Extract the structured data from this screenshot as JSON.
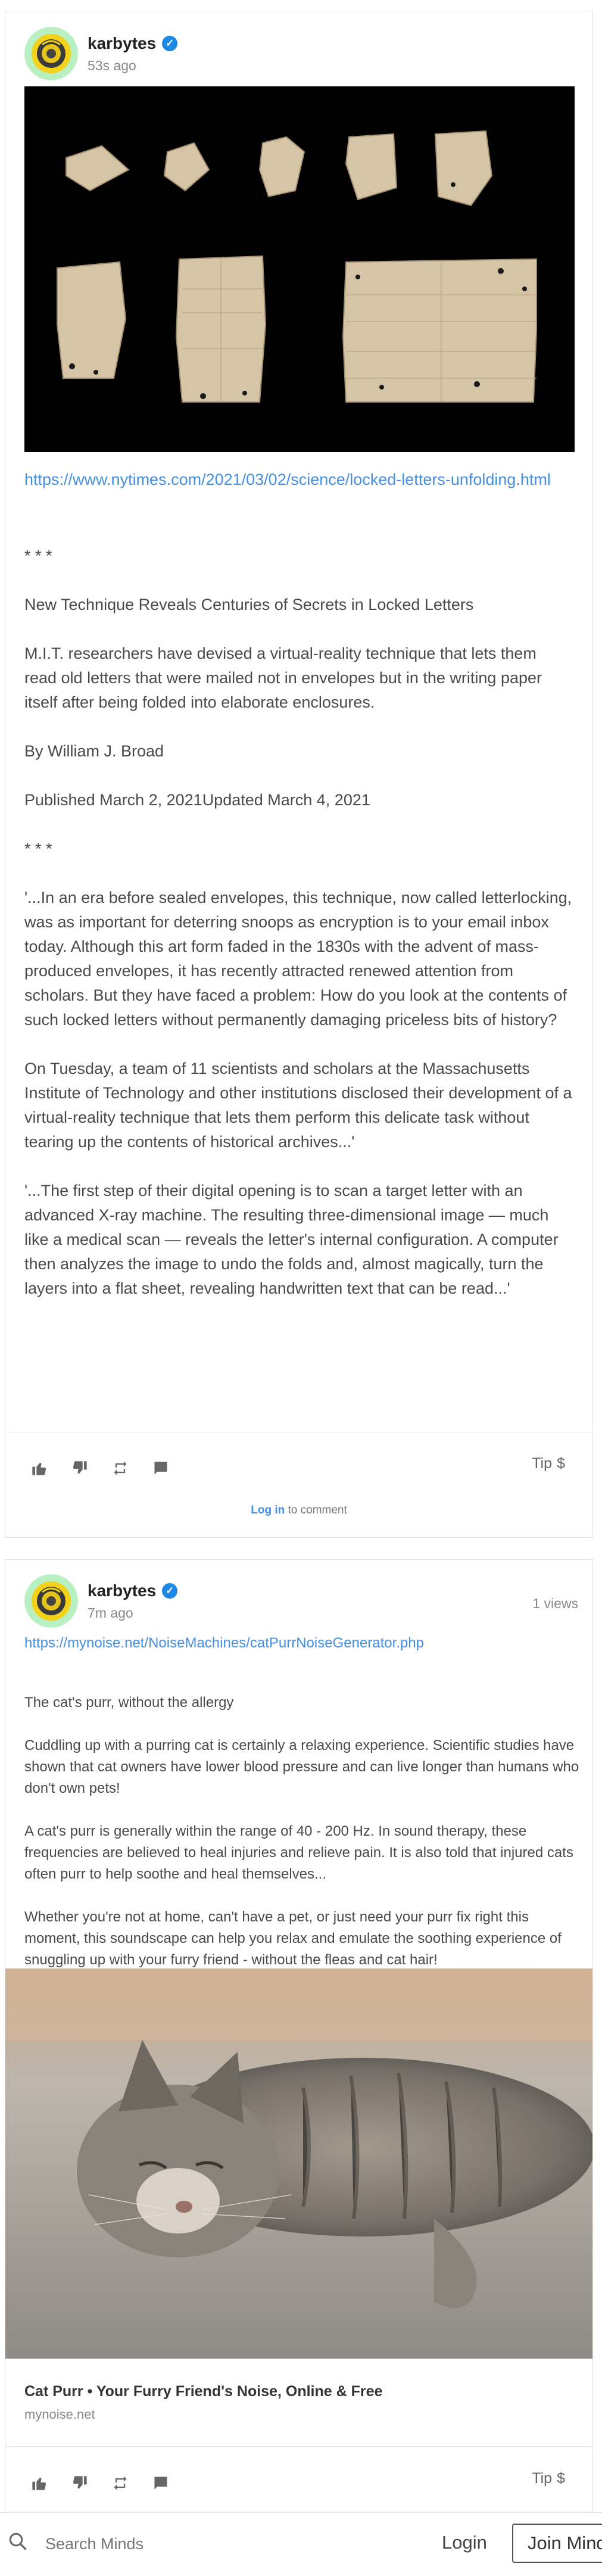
{
  "post1": {
    "owner": {
      "name": "karbytes",
      "time": "53s ago"
    },
    "link": "https://www.nytimes.com/2021/03/02/science/locked-letters-unfolding.html",
    "paragraphs": [
      "* * *",
      "New Technique Reveals Centuries of Secrets in Locked Letters",
      "M.I.T. researchers have devised a virtual-reality technique that lets them read old letters that were mailed not in envelopes but in the writing paper itself after being folded into elaborate enclosures.",
      "By William J. Broad",
      "Published March 2, 2021Updated March 4, 2021",
      "* * *",
      "'...In an era before sealed envelopes, this technique, now called letterlocking, was as important for deterring snoops as encryption is to your email inbox today. Although this art form faded in the 1830s with the advent of mass-produced envelopes, it has recently attracted renewed attention from scholars. But they have faced a problem: How do you look at the contents of such locked letters without permanently damaging priceless bits of history?",
      "On Tuesday, a team of 11 scientists and scholars at the Massachusetts Institute of Technology and other institutions disclosed their development of a virtual-reality technique that lets them perform this delicate task without tearing up the contents of historical archives...'",
      "'...The first step of their digital opening is to scan a target letter with an advanced X-ray machine. The resulting three-dimensional image — much like a medical scan — reveals the letter's internal configuration. A computer then analyzes the image to undo the folds and, almost magically, turn the layers into a flat sheet, revealing handwritten text that can be read...'"
    ],
    "tip_label": "Tip",
    "tip_symbol": "$",
    "login_link": "Log in",
    "comment_suffix": " to comment"
  },
  "post2": {
    "owner": {
      "name": "karbytes",
      "time": "7m ago"
    },
    "views": "1 views",
    "link": "https://mynoise.net/NoiseMachines/catPurrNoiseGenerator.php",
    "paragraphs": [
      "The cat's purr, without the allergy",
      "Cuddling up with a purring cat is certainly a relaxing experience. Scientific studies have shown that cat owners have lower blood pressure and can live longer than humans who don't own pets!",
      "A cat's purr is generally within the range of 40 - 200 Hz. In sound therapy, these frequencies are believed to heal injuries and relieve pain. It is also told that injured cats often purr to help soothe and heal themselves...",
      "Whether you're not at home, can't have a pet, or just need your purr fix right this moment, this soundscape can help you relax and emulate the soothing experience of snuggling up with your furry friend - without the fleas and cat hair!"
    ],
    "preview": {
      "title": "Cat Purr • Your Furry Friend's Noise, Online & Free",
      "host": "mynoise.net"
    },
    "tip_label": "Tip",
    "tip_symbol": "$"
  },
  "bottom_bar": {
    "search_placeholder": "Search Minds",
    "login_label": "Login",
    "join_label": "Join Minds"
  },
  "icons": [
    "thumbs-up-icon",
    "thumbs-down-icon",
    "remind-icon",
    "comment-icon",
    "search-icon",
    "verified-icon"
  ],
  "colors": {
    "link": "#4690df",
    "verified": "#1e88e5",
    "text": "#4a4a4a",
    "muted": "#888888"
  }
}
